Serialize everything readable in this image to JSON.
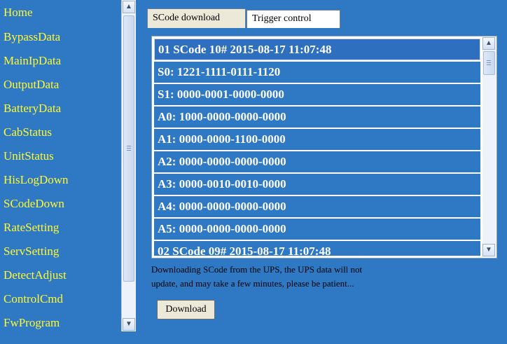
{
  "nav": {
    "items": [
      "Home",
      "BypassData",
      "MainIpData",
      "OutputData",
      "BatteryData",
      "CabStatus",
      "UnitStatus",
      "HisLogDown",
      "SCodeDown",
      "RateSetting",
      "ServSetting",
      "DetectAdjust",
      "ControlCmd",
      "FwProgram"
    ]
  },
  "tabs": [
    "SCode download",
    "Trigger control"
  ],
  "scode_list": {
    "rows": [
      "01 SCode 10# 2015-08-17 11:07:48",
      "S0: 1221-1111-0111-1120",
      "S1: 0000-0001-0000-0000",
      "A0: 1000-0000-0000-0000",
      "A1: 0000-0000-1100-0000",
      "A2: 0000-0000-0000-0000",
      "A3: 0000-0010-0010-0000",
      "A4: 0000-0000-0000-0000",
      "A5: 0000-0000-0000-0000",
      "02 SCode 09# 2015-08-17 11:07:48"
    ]
  },
  "message": {
    "line1": "Downloading SCode from the UPS, the UPS data will not",
    "line2": "update, and may take a few minutes, please be patient..."
  },
  "download_label": "Download",
  "colors": {
    "panel_blue": "#2f79c4",
    "nav_text": "#fff833",
    "tab_active": "#ece9d8"
  },
  "icons": {
    "scroll_up": "triangle-up-icon",
    "scroll_down": "triangle-down-icon"
  }
}
